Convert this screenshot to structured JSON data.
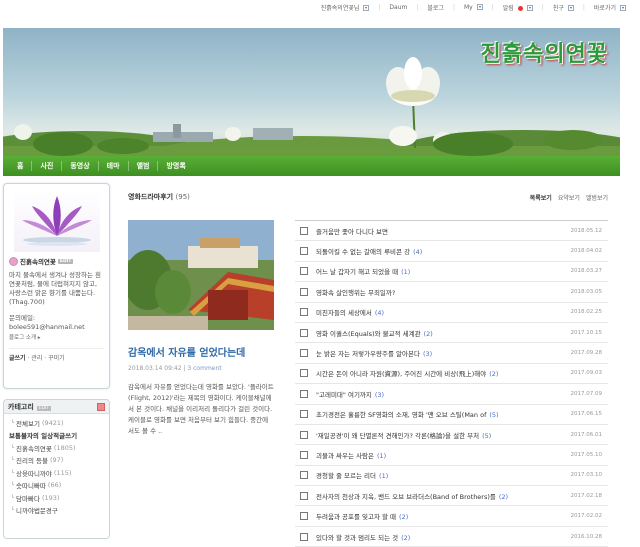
{
  "topbar": {
    "items": [
      {
        "label": "진흙속의연꽃님",
        "dd": true
      },
      {
        "label": "Daum",
        "dd": false
      },
      {
        "label": "블로그",
        "dd": false
      },
      {
        "label": "My",
        "dd": true
      },
      {
        "label": "알림",
        "dd": true,
        "dot": true
      },
      {
        "label": "친구",
        "dd": true
      },
      {
        "label": "바로가기",
        "dd": true
      }
    ]
  },
  "banner": {
    "title": "진흙속의연꽃"
  },
  "nav": {
    "items": [
      "홈",
      "사진",
      "동영상",
      "테마",
      "앨범",
      "방명록"
    ]
  },
  "profile": {
    "name": "진흙속의연꽃",
    "badge": "EDIT",
    "description": "마치 물속에서 생겨나 성장하는 흰 연꽃처럼, 물에 더럽혀지지 않고, 사랑스런 맑은 향기를 내뿜는다. (Thag.700)",
    "contact_label": "문의메일:",
    "email": "bolee591@hanmail.net",
    "intro_link": "블로그 소개 ▸",
    "links": [
      "글쓰기",
      "관리",
      "꾸미기"
    ]
  },
  "category": {
    "title": "카테고리",
    "edit": "EDIT",
    "items": [
      {
        "label": "전체보기",
        "count": "(9421)",
        "type": "sub"
      },
      {
        "label": "보통불자의 일상적글쓰기",
        "count": "",
        "type": "bold"
      },
      {
        "label": "진흙속의연꽃",
        "count": "(1805)",
        "type": "sub"
      },
      {
        "label": "진리의 등불",
        "count": "(97)",
        "type": "sub"
      },
      {
        "label": "상윳따니까야",
        "count": "(115)",
        "type": "sub"
      },
      {
        "label": "숫따니빠따",
        "count": "(66)",
        "type": "sub"
      },
      {
        "label": "담마빠다",
        "count": "(193)",
        "type": "sub"
      },
      {
        "label": "니까야법문경구",
        "count": "",
        "type": "sub"
      }
    ]
  },
  "main": {
    "heading": "영화드라마후기",
    "count": "(95)",
    "views": [
      "목록보기",
      "요약보기",
      "앨범보기"
    ],
    "feature": {
      "title": "감옥에서 자유를 얻었다는데",
      "date": "2018.03.14 09:42",
      "comment": "3 comment",
      "body": "감옥에서 자유를 얻었다는데 영화를 보았다. '플라이트(Flight, 2012)'라는 제목의 영화이다. 케이블채널에서 본 것이다. 채널을 이리저리 돌리다가 걸린 것이다. 케이블로 영화를 보면 처음부터 보기 힘들다. 중간에서도 볼 수 .."
    },
    "posts": [
      {
        "title": "즐거움만 좇아 다니다 보면",
        "comments": "",
        "date": "2018.05.12"
      },
      {
        "title": "되돌이킬 수 없는 갈애의 루비콘 강",
        "comments": "(4)",
        "date": "2018.04.02"
      },
      {
        "title": "어느 날 갑자기 해고 되었을 때",
        "comments": "(1)",
        "date": "2018.03.27"
      },
      {
        "title": "영화속 살인행위는 무죄일까?",
        "comments": "",
        "date": "2018.03.05"
      },
      {
        "title": "미친자들의 세상에서",
        "comments": "(4)",
        "date": "2018.02.25"
      },
      {
        "title": "영화 이퀄스(Equals)와 불교적 세계관",
        "comments": "(2)",
        "date": "2017.10.15"
      },
      {
        "title": "눈 밝은 자는 저렇가우량주를 알아본다",
        "comments": "(3)",
        "date": "2017.09.28"
      },
      {
        "title": "시간은 돈이 아니라 자원(資源), 주어진 시간에 비상(飛上)해야",
        "comments": "(2)",
        "date": "2017.09.03"
      },
      {
        "title": "\"고레미대\" 여기까지",
        "comments": "(3)",
        "date": "2017.07.09"
      },
      {
        "title": "초기경전은 훌륭한 SF영화의 소재, 영화 '맨 오브 스틸(Man of",
        "comments": "(5)",
        "date": "2017.06.15"
      },
      {
        "title": "'재일공경'이 왜 단멸론적 견해인가? 각론(格論)을 설한 부처",
        "comments": "(5)",
        "date": "2017.06.01"
      },
      {
        "title": "괴물과 싸우는 사람은",
        "comments": "(1)",
        "date": "2017.05.10"
      },
      {
        "title": "경청할 줄 모르는 리더",
        "comments": "(1)",
        "date": "2017.03.10"
      },
      {
        "title": "전사자의 천상과 지옥, 밴드 오브 브라더스(Band of Brothers)를",
        "comments": "(2)",
        "date": "2017.02.18"
      },
      {
        "title": "두려움과 공포를 잊고자 할 때",
        "comments": "(2)",
        "date": "2017.02.02"
      },
      {
        "title": "있다와 할 것과 멈리도 되는 것",
        "comments": "(2)",
        "date": "2016.10.28"
      }
    ]
  },
  "colors": {
    "nav_green": "#4a9f2b",
    "title_blue": "#2d6aa8",
    "comment_blue": "#4a6fc0",
    "logo_green": "#2a9a3a"
  }
}
